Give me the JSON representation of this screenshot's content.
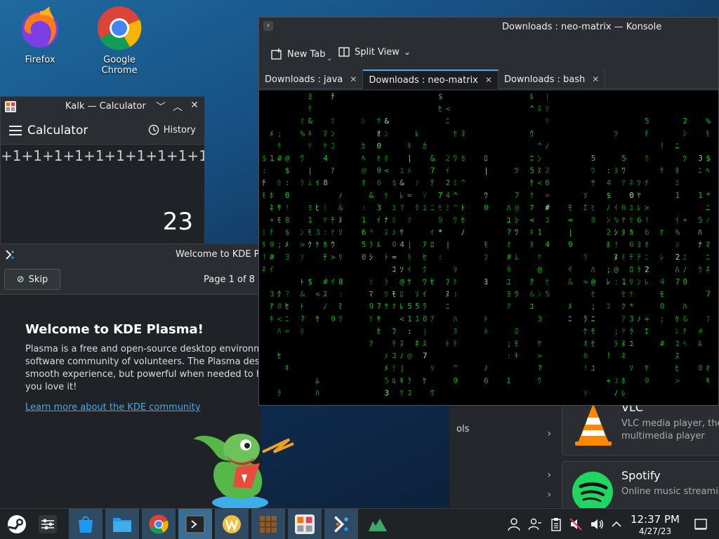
{
  "desktop": {
    "icons": [
      {
        "label": "Firefox"
      },
      {
        "label": "Google Chrome"
      }
    ]
  },
  "kalk": {
    "window_title": "Kalk — Calculator",
    "app_title": "Calculator",
    "history_label": "History",
    "expression": "+1+1+1+1+1+1+1+1+1+1+1",
    "result": "23"
  },
  "welcome": {
    "window_title": "Welcome to KDE Plasma",
    "skip_label": "Skip",
    "page_indicator": "Page 1 of 8",
    "heading": "Welcome to KDE Plasma!",
    "body_lines": [
      "Plasma is a free and open-source desktop environment",
      "software community of volunteers. The Plasma desktop",
      "smooth experience, but powerful when needed to help",
      "you love it!"
    ],
    "learn_more": "Learn more about the KDE community"
  },
  "konsole": {
    "window_title": "Downloads : neo-matrix — Konsole",
    "new_tab_label": "New Tab",
    "split_view_label": "Split View",
    "tabs": [
      {
        "label": "Downloads : java",
        "active": false
      },
      {
        "label": "Downloads : neo-matrix",
        "active": true
      },
      {
        "label": "Downloads : bash",
        "active": false
      }
    ]
  },
  "discover": {
    "category_partial": "ols",
    "apps": [
      {
        "name": "VLC",
        "desc_lines": [
          "VLC media player, the o",
          "multimedia player"
        ]
      },
      {
        "name": "Spotify",
        "desc_lines": [
          "Online music streaming"
        ]
      }
    ]
  },
  "taskbar": {
    "time": "12:37 PM",
    "date": "4/27/23",
    "items": [
      "steam-icon",
      "settings-icon",
      "discover-icon",
      "dolphin-icon",
      "chrome-icon",
      "konsole-icon",
      "kwrite-icon",
      "minecraft-icon",
      "kalk-icon",
      "welcome-icon",
      "system-monitor-icon"
    ]
  },
  "colors": {
    "matrix_green": "#00e000",
    "matrix_bright": "#9bff9b",
    "accent": "#3daee9"
  }
}
